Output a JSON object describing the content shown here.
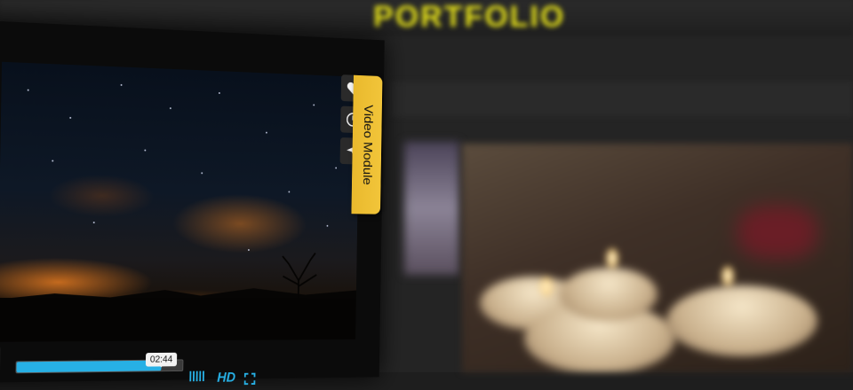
{
  "background_site": {
    "logo_text": "PORTFOLIO",
    "nav_items": [
      "",
      ""
    ]
  },
  "video_module": {
    "tab_label": "Video Module",
    "side_buttons": [
      {
        "icon": "heart-icon"
      },
      {
        "icon": "clock-icon"
      },
      {
        "icon": "send-icon"
      }
    ],
    "controls": {
      "play_icon": "play-icon",
      "current_time": "02:44",
      "progress": 0.87,
      "volume_icon": "volume-bars-icon",
      "quality_label": "HD",
      "fullscreen_icon": "fullscreen-icon"
    },
    "colors": {
      "accent": "#27b0e5",
      "tab": "#f2c53a"
    }
  }
}
